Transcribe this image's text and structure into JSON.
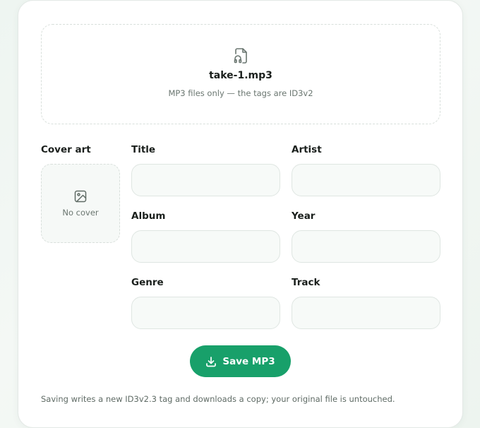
{
  "dropzone": {
    "file_name": "take-1.mp3",
    "hint": "MP3 files only — the tags are ID3v2",
    "icon": "audio-file-icon"
  },
  "cover": {
    "label": "Cover art",
    "placeholder_text": "No cover",
    "icon": "image-icon"
  },
  "fields": {
    "title": {
      "label": "Title",
      "value": ""
    },
    "artist": {
      "label": "Artist",
      "value": ""
    },
    "album": {
      "label": "Album",
      "value": ""
    },
    "year": {
      "label": "Year",
      "value": ""
    },
    "genre": {
      "label": "Genre",
      "value": ""
    },
    "track": {
      "label": "Track",
      "value": ""
    }
  },
  "save": {
    "label": "Save MP3",
    "icon": "download-icon"
  },
  "footnote": "Saving writes a new ID3v2.3 tag and downloads a copy; your original file is untouched.",
  "colors": {
    "accent": "#18a06a",
    "field_bg": "#f7faf8",
    "border": "#dfe6e2"
  }
}
